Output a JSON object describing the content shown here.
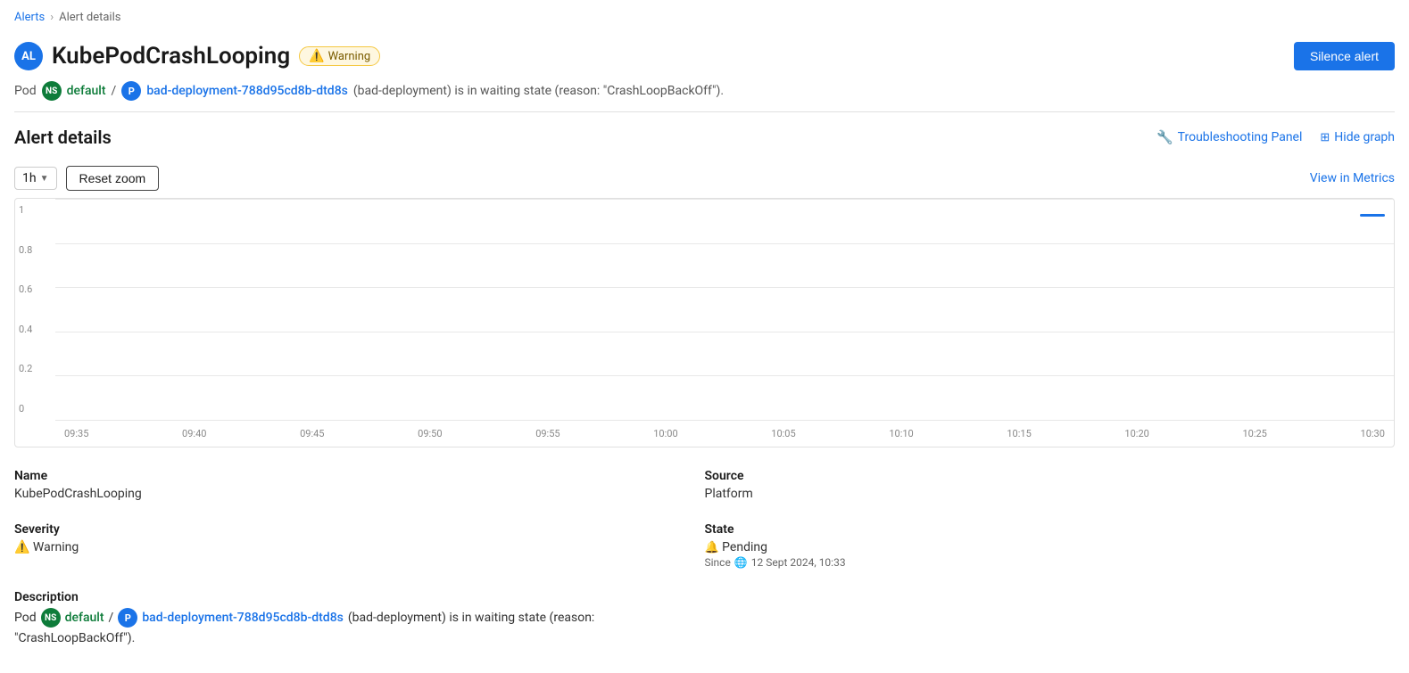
{
  "breadcrumb": {
    "parent_label": "Alerts",
    "current_label": "Alert details"
  },
  "alert": {
    "avatar_initials": "AL",
    "name": "KubePodCrashLooping",
    "warning_badge": "Warning",
    "silence_btn_label": "Silence alert"
  },
  "pod_line": {
    "prefix": "Pod",
    "ns_label": "NS",
    "ns_link_text": "default",
    "sep": "/",
    "p_label": "P",
    "pod_link_text": "bad-deployment-788d95cd8b-dtd8s",
    "description": "(bad-deployment) is in waiting state (reason: \"CrashLoopBackOff\")."
  },
  "section_header": {
    "title": "Alert details",
    "troubleshooting_panel_label": "Troubleshooting Panel",
    "hide_graph_label": "Hide graph"
  },
  "graph": {
    "time_range": "1h",
    "reset_zoom_label": "Reset zoom",
    "view_in_metrics_label": "View in Metrics",
    "y_axis": [
      "0",
      "0.2",
      "0.4",
      "0.6",
      "0.8",
      "1"
    ],
    "x_axis": [
      "09:35",
      "09:40",
      "09:45",
      "09:50",
      "09:55",
      "10:00",
      "10:05",
      "10:10",
      "10:15",
      "10:20",
      "10:25",
      "10:30"
    ]
  },
  "details": {
    "name_label": "Name",
    "name_value": "KubePodCrashLooping",
    "source_label": "Source",
    "source_value": "Platform",
    "severity_label": "Severity",
    "severity_value": "Warning",
    "state_label": "State",
    "state_value": "Pending",
    "state_since_prefix": "Since",
    "state_since_date": "12 Sept 2024, 10:33",
    "description_label": "Description",
    "desc_ns_label": "NS",
    "desc_ns_link_text": "default",
    "desc_p_label": "P",
    "desc_pod_link_text": "bad-deployment-788d95cd8b-dtd8s",
    "desc_suffix": " (bad-deployment) is in waiting state (reason:",
    "desc_reason": "\"CrashLoopBackOff\")."
  }
}
